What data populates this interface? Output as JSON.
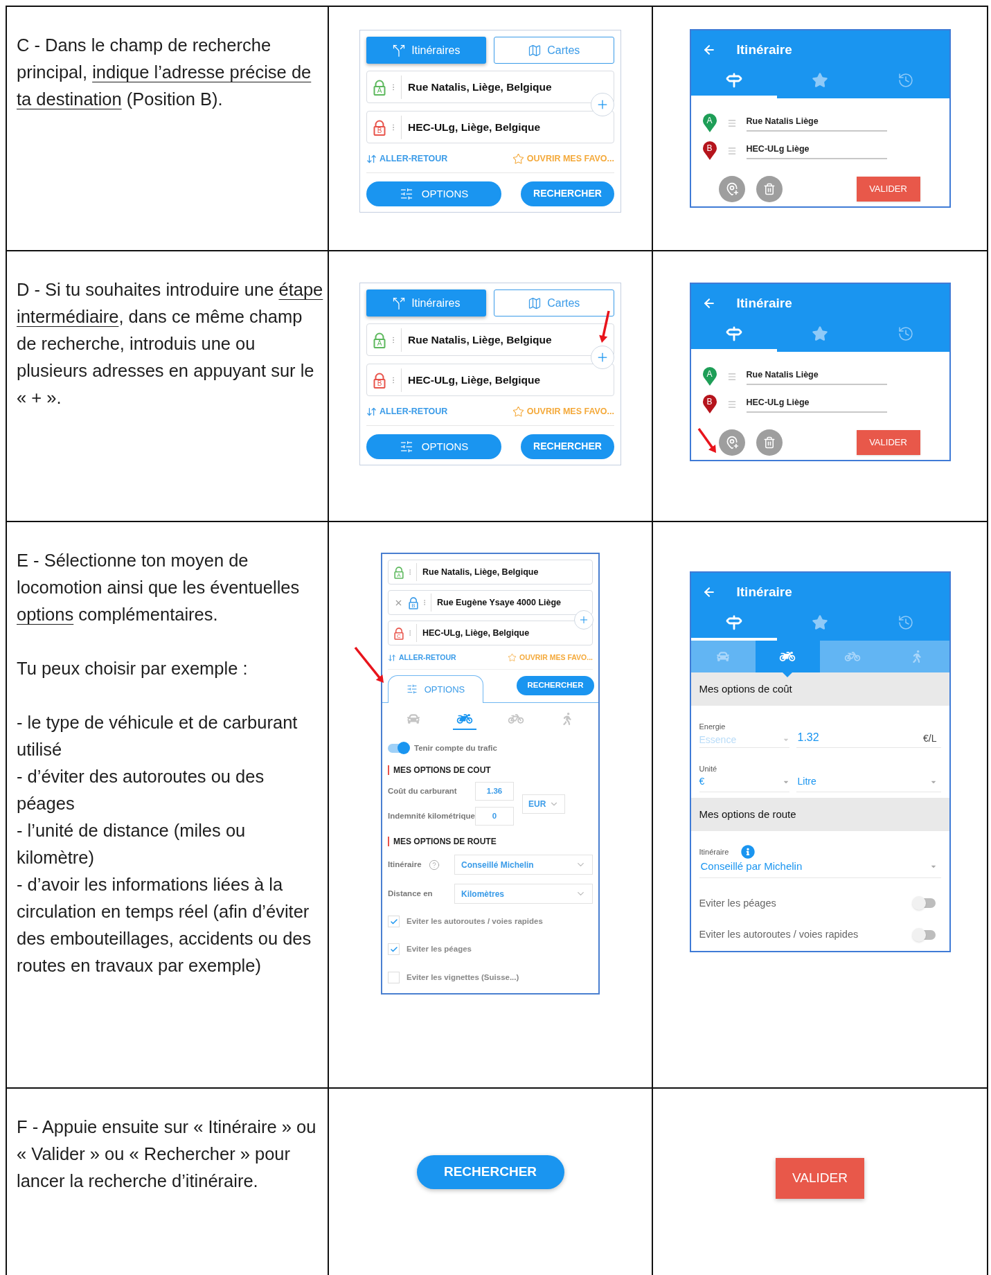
{
  "rows": [
    {
      "instruction": [
        {
          "kind": "paragraph",
          "segments": [
            {
              "text": "C - Dans le champ de recherche principal, ",
              "underline": false
            },
            {
              "text": "indique l’adresse précise de ta destination",
              "underline": true
            },
            {
              "text": " (Position B).",
              "underline": false
            }
          ]
        }
      ],
      "web": {
        "kind": "search",
        "pointer_arrow": false,
        "tabs": [
          {
            "label": "Itinéraires",
            "kind": "route",
            "selected": true
          },
          {
            "label": "Cartes",
            "kind": "map",
            "selected": false
          }
        ],
        "stops": [
          {
            "letter": "A",
            "label": "Rue Natalis, Liège, Belgique",
            "color": "#5cb85c",
            "removable": false
          },
          {
            "letter": "B",
            "label": "HEC-ULg, Liège, Belgique",
            "color": "#e8534a",
            "removable": false
          }
        ],
        "round_trip": "ALLER-RETOUR",
        "favorites": "OUVRIR MES FAVO...",
        "options_button": "OPTIONS",
        "search_button": "RECHERCHER"
      },
      "app": {
        "kind": "stops",
        "pointer_arrow": false,
        "title": "Itinéraire",
        "tabs": [
          {
            "kind": "signpost",
            "selected": true
          },
          {
            "kind": "star",
            "selected": false
          },
          {
            "kind": "history",
            "selected": false
          }
        ],
        "stops": [
          {
            "letter": "A",
            "label": "Rue Natalis Liège",
            "color": "#1e9e57"
          },
          {
            "letter": "B",
            "label": "HEC-ULg Liège",
            "color": "#b5141c"
          }
        ],
        "validate_button": "VALIDER"
      }
    },
    {
      "instruction": [
        {
          "kind": "paragraph",
          "segments": [
            {
              "text": "D - Si tu souhaites introduire une ",
              "underline": false
            },
            {
              "text": "étape intermédiaire",
              "underline": true
            },
            {
              "text": ", dans ce même champ de recherche, introduis une ou plusieurs adresses en appuyant sur le « + ».",
              "underline": false
            }
          ]
        }
      ],
      "web": {
        "kind": "search",
        "pointer_arrow": true,
        "tabs": [
          {
            "label": "Itinéraires",
            "kind": "route",
            "selected": true
          },
          {
            "label": "Cartes",
            "kind": "map",
            "selected": false
          }
        ],
        "stops": [
          {
            "letter": "A",
            "label": "Rue Natalis, Liège, Belgique",
            "color": "#5cb85c",
            "removable": false
          },
          {
            "letter": "B",
            "label": "HEC-ULg, Liège, Belgique",
            "color": "#e8534a",
            "removable": false
          }
        ],
        "round_trip": "ALLER-RETOUR",
        "favorites": "OUVRIR MES FAVO...",
        "options_button": "OPTIONS",
        "search_button": "RECHERCHER"
      },
      "app": {
        "kind": "stops",
        "pointer_arrow": true,
        "title": "Itinéraire",
        "tabs": [
          {
            "kind": "signpost",
            "selected": true
          },
          {
            "kind": "star",
            "selected": false
          },
          {
            "kind": "history",
            "selected": false
          }
        ],
        "stops": [
          {
            "letter": "A",
            "label": "Rue Natalis Liège",
            "color": "#1e9e57"
          },
          {
            "letter": "B",
            "label": "HEC-ULg Liège",
            "color": "#b5141c"
          }
        ],
        "validate_button": "VALIDER"
      }
    },
    {
      "instruction": [
        {
          "kind": "paragraph",
          "segments": [
            {
              "text": "E - Sélectionne ton moyen de locomotion ainsi que les éventuelles ",
              "underline": false
            },
            {
              "text": "options",
              "underline": true
            },
            {
              "text": " complémentaires.",
              "underline": false
            }
          ]
        },
        {
          "kind": "paragraph",
          "segments": [
            {
              "text": "Tu peux choisir par exemple :",
              "underline": false
            }
          ]
        },
        {
          "kind": "list",
          "items": [
            "- le type de véhicule et de carburant utilisé",
            "- d’éviter des autoroutes ou des péages",
            "- l’unité de distance (miles ou kilomètre)",
            "- d’avoir les informations liées à la circulation en temps réel (afin d’éviter des embouteillages, accidents ou des routes en travaux par exemple)"
          ]
        }
      ],
      "web": {
        "kind": "options",
        "pointer_arrow": true,
        "stops": [
          {
            "letter": "A",
            "label": "Rue Natalis, Liège, Belgique",
            "color": "#5cb85c",
            "removable": false
          },
          {
            "letter": "B",
            "label": "Rue Eugène Ysaye 4000 Liège",
            "color": "#3a9be8",
            "removable": true
          },
          {
            "letter": "C",
            "label": "HEC-ULg, Liège, Belgique",
            "color": "#e8534a",
            "removable": false
          }
        ],
        "round_trip": "ALLER-RETOUR",
        "favorites": "OUVRIR MES FAVO...",
        "options_tab": {
          "label": "OPTIONS",
          "selected": true
        },
        "search_button": "RECHERCHER",
        "modes": [
          {
            "kind": "car",
            "selected": false
          },
          {
            "kind": "motorcycle",
            "selected": true
          },
          {
            "kind": "bicycle",
            "selected": false
          },
          {
            "kind": "walk",
            "selected": false
          }
        ],
        "traffic": {
          "label": "Tenir compte du trafic",
          "on": true
        },
        "cost_heading": "MES OPTIONS DE COUT",
        "fuel_cost": {
          "label": "Coût du carburant",
          "value": "1.36"
        },
        "mileage": {
          "label": "Indemnité kilométrique",
          "value": "0"
        },
        "currency": "EUR",
        "route_heading": "MES OPTIONS DE ROUTE",
        "route_type": {
          "label": "Itinéraire",
          "value": "Conseillé Michelin"
        },
        "distance": {
          "label": "Distance en",
          "value": "Kilomètres"
        },
        "avoid": [
          {
            "label": "Eviter les autoroutes / voies rapides",
            "checked": true
          },
          {
            "label": "Eviter les péages",
            "checked": true
          },
          {
            "label": "Eviter les vignettes (Suisse...)",
            "checked": false
          }
        ]
      },
      "app": {
        "kind": "options",
        "pointer_arrow": false,
        "title": "Itinéraire",
        "tabs": [
          {
            "kind": "signpost",
            "selected": true
          },
          {
            "kind": "star",
            "selected": false
          },
          {
            "kind": "history",
            "selected": false
          }
        ],
        "modes": [
          {
            "kind": "car",
            "selected": false
          },
          {
            "kind": "motorcycle",
            "selected": true
          },
          {
            "kind": "bicycle",
            "selected": false
          },
          {
            "kind": "walk",
            "selected": false
          }
        ],
        "cost_heading": "Mes options de coût",
        "energy": {
          "label": "Energie",
          "value": "Essence",
          "disabled": true
        },
        "price": {
          "value": "1.32",
          "unit": "€/L"
        },
        "unit": {
          "label": "Unité",
          "currency": "€",
          "volume": "Litre"
        },
        "route_heading": "Mes options de route",
        "route": {
          "label": "Itinéraire",
          "value": "Conseillé par Michelin"
        },
        "toggles": [
          {
            "label": "Eviter les péages",
            "on": false
          },
          {
            "label": "Eviter les autoroutes / voies rapides",
            "on": false
          }
        ]
      }
    },
    {
      "instruction": [
        {
          "kind": "paragraph",
          "segments": [
            {
              "text": "F - Appuie ensuite sur « Itinéraire » ou « Valider » ou « Rechercher » pour lancer la recherche d’itinéraire.",
              "underline": false
            }
          ]
        }
      ],
      "web": {
        "kind": "button",
        "search_button": "RECHERCHER"
      },
      "app": {
        "kind": "button",
        "validate_button": "VALIDER"
      }
    }
  ]
}
